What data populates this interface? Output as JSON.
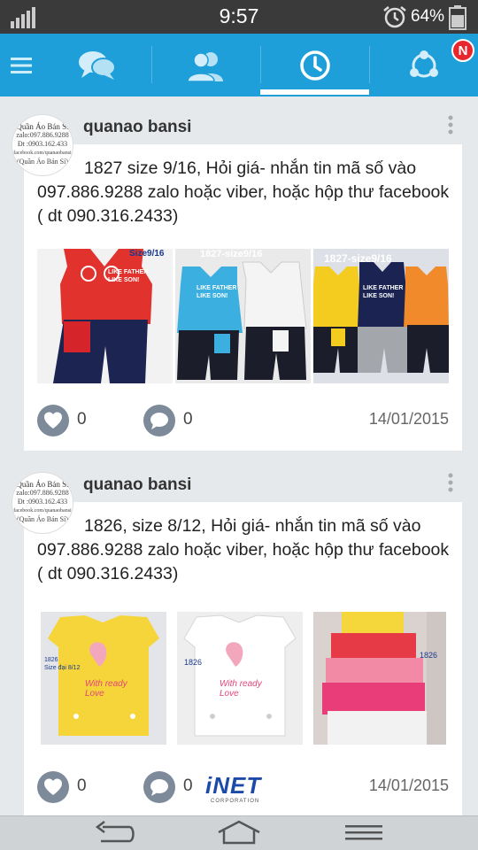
{
  "status_bar": {
    "time": "9:57",
    "battery": "64%"
  },
  "nav": {
    "tabs": [
      {
        "name": "menu"
      },
      {
        "name": "chat"
      },
      {
        "name": "friends"
      },
      {
        "name": "timeline",
        "active": true
      },
      {
        "name": "notifications"
      }
    ],
    "badge": "N"
  },
  "posts": [
    {
      "author": "quanao bansi",
      "avatar_lines": [
        "Quần Áo Bán Sỉ",
        "zalo:097.886.9288",
        "Đt :0903.162.433",
        "facebook.com/quanaobansi",
        "(Quần Áo Bán Sỉ)"
      ],
      "text": "1827 size 9/16, Hỏi giá-  nhắn tin mã số vào 097.886.9288 zalo hoặc viber, hoặc hộp thư facebook ( dt 090.316.2433)",
      "photos": [
        {
          "caption": "Size9/16",
          "slogan": "LIKE FATHER LIKE SON!"
        },
        {
          "caption": "1827-size9/16",
          "slogan": "LIKE FATHER LIKE SON!"
        },
        {
          "caption": "1827-size9/16",
          "slogan": "LIKE FATHER LIKE SON!"
        }
      ],
      "likes": "0",
      "comments": "0",
      "date": "14/01/2015"
    },
    {
      "author": "quanao bansi",
      "avatar_lines": [
        "Quần Áo Bán Sỉ",
        "zalo:097.886.9288",
        "Đt :0903.162.433",
        "facebook.com/quanaobansi",
        "(Quần Áo Bán Sỉ)"
      ],
      "text": "1826, size 8/12, Hỏi giá-  nhắn tin mã số vào 097.886.9288 zalo hoặc viber, hoặc hộp thư facebook ( dt 090.316.2433)",
      "photos": [
        {
          "caption": "1826",
          "caption2": "Size đại 8/12",
          "slogan": "With ready Love"
        },
        {
          "caption": "1826",
          "slogan": "With ready Love"
        },
        {
          "caption": "1826",
          "slogan": ""
        }
      ],
      "likes": "0",
      "comments": "0",
      "date": "14/01/2015"
    }
  ],
  "watermark": {
    "brand": "iNET",
    "sub": "CORPORATION"
  },
  "colors": {
    "nav_blue": "#1f9fd9",
    "badge_red": "#e8262d",
    "icon_grey": "#7d8a99"
  }
}
